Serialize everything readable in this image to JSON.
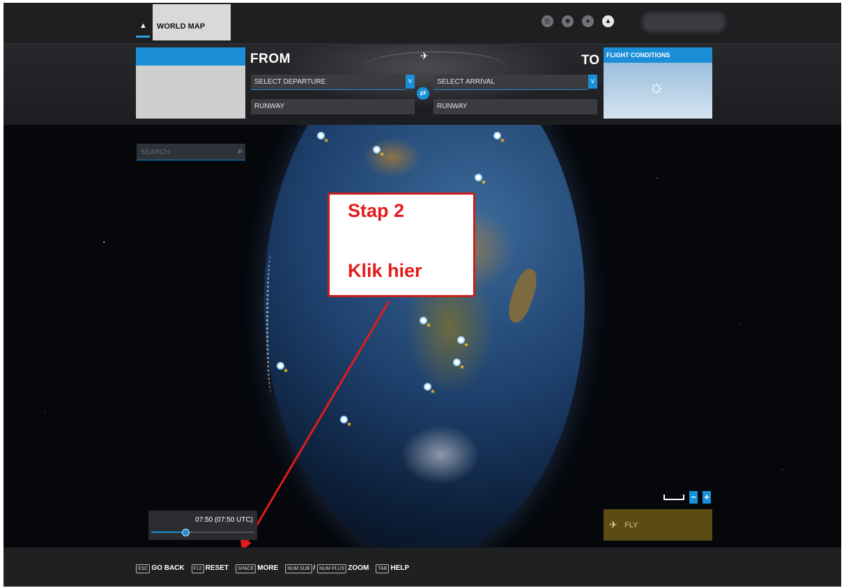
{
  "header": {
    "tab_label": "WORLD MAP",
    "home_icon": "home-icon",
    "icons": [
      "rank-icon",
      "friends-icon",
      "profile-icon",
      "notification-bell-icon"
    ]
  },
  "flight": {
    "from_label": "FROM",
    "to_label": "TO",
    "departure_placeholder": "SELECT DEPARTURE",
    "arrival_placeholder": "SELECT ARRIVAL",
    "departure_runway": "RUNWAY",
    "arrival_runway": "RUNWAY",
    "conditions_label": "FLIGHT CONDITIONS",
    "conditions_icon": "sun-icon"
  },
  "search": {
    "placeholder": "SEARCH"
  },
  "annotation": {
    "line1": "Stap 2",
    "line2": "Klik hier",
    "color": "#e41b1b"
  },
  "time": {
    "value": "07:50 (07:50 UTC)",
    "progress": 0.33
  },
  "zoom": {
    "minus": "−",
    "plus": "+"
  },
  "fly_button": {
    "label": "FLY"
  },
  "footer": {
    "hints": [
      {
        "key": "ESC",
        "label": "GO BACK"
      },
      {
        "key": "F12",
        "label": "RESET"
      },
      {
        "key": "SPACE",
        "label": "MORE"
      },
      {
        "key": "NUM SUB",
        "label": "/"
      },
      {
        "key": "NUM PLUS",
        "label": "ZOOM"
      },
      {
        "key": "TAB",
        "label": "HELP"
      }
    ]
  },
  "colors": {
    "accent": "#1a8fd8",
    "fly_bg": "#5a4c12"
  }
}
